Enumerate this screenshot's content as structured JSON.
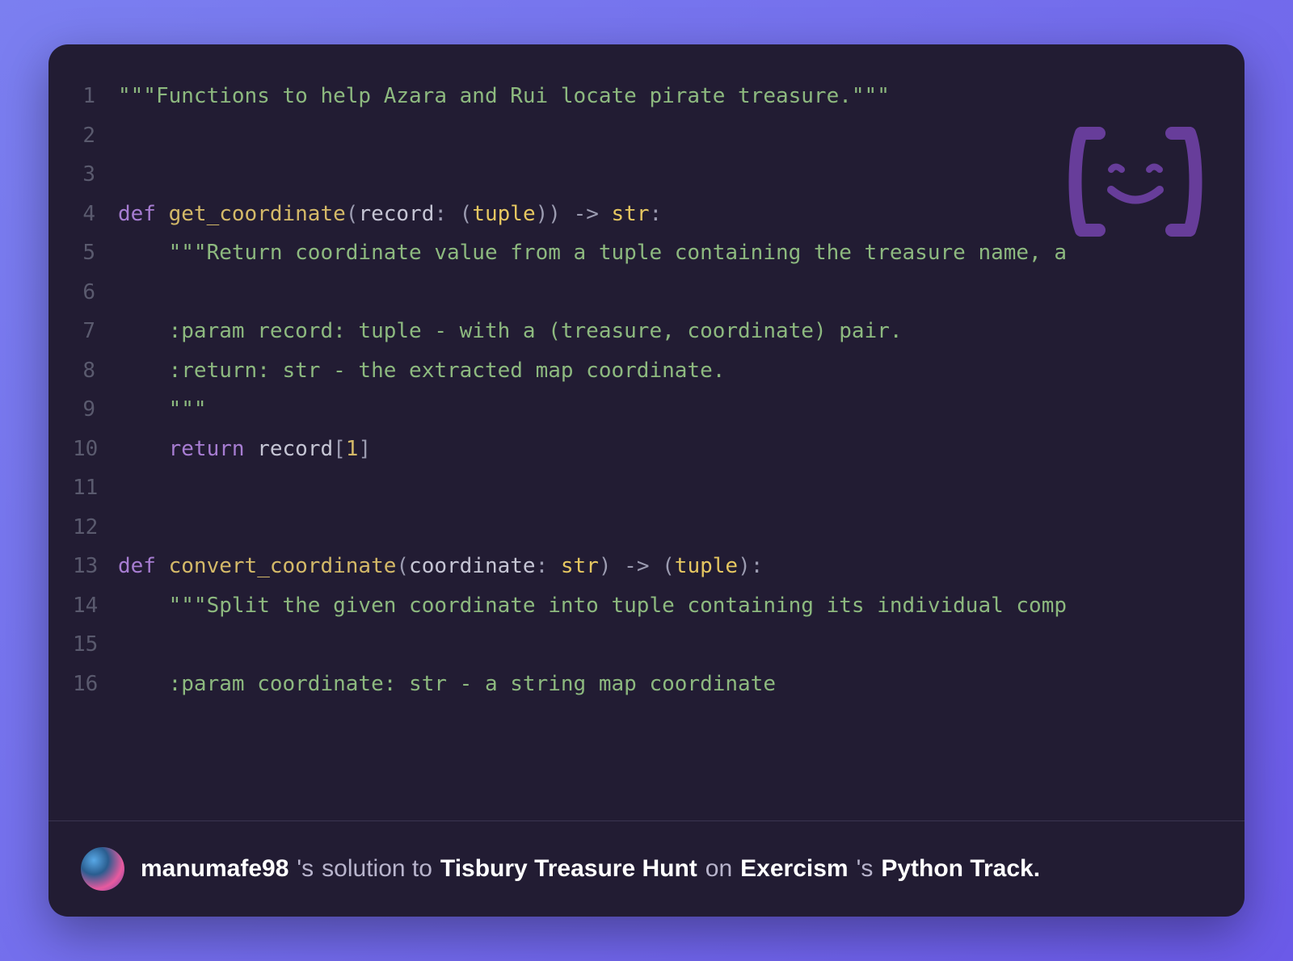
{
  "code": {
    "lines": [
      {
        "n": 1,
        "tokens": [
          [
            "t-str",
            "\"\"\"Functions to help Azara and Rui locate pirate treasure.\"\"\""
          ]
        ]
      },
      {
        "n": 2,
        "tokens": []
      },
      {
        "n": 3,
        "tokens": []
      },
      {
        "n": 4,
        "tokens": [
          [
            "t-key",
            "def "
          ],
          [
            "t-func",
            "get_coordinate"
          ],
          [
            "t-punct",
            "("
          ],
          [
            "t-param",
            "record"
          ],
          [
            "t-punct",
            ": ("
          ],
          [
            "t-type",
            "tuple"
          ],
          [
            "t-punct",
            ")) -> "
          ],
          [
            "t-type",
            "str"
          ],
          [
            "t-punct",
            ":"
          ]
        ]
      },
      {
        "n": 5,
        "tokens": [
          [
            "",
            "    "
          ],
          [
            "t-str",
            "\"\"\"Return coordinate value from a tuple containing the treasure name, a"
          ]
        ]
      },
      {
        "n": 6,
        "tokens": []
      },
      {
        "n": 7,
        "tokens": [
          [
            "",
            "    "
          ],
          [
            "t-str",
            ":param record: tuple - with a (treasure, coordinate) pair."
          ]
        ]
      },
      {
        "n": 8,
        "tokens": [
          [
            "",
            "    "
          ],
          [
            "t-str",
            ":return: str - the extracted map coordinate."
          ]
        ]
      },
      {
        "n": 9,
        "tokens": [
          [
            "",
            "    "
          ],
          [
            "t-str",
            "\"\"\""
          ]
        ]
      },
      {
        "n": 10,
        "tokens": [
          [
            "",
            "    "
          ],
          [
            "t-key",
            "return"
          ],
          [
            "",
            ""
          ],
          [
            "t-param",
            " record"
          ],
          [
            "t-punct",
            "["
          ],
          [
            "t-num",
            "1"
          ],
          [
            "t-punct",
            "]"
          ]
        ]
      },
      {
        "n": 11,
        "tokens": []
      },
      {
        "n": 12,
        "tokens": []
      },
      {
        "n": 13,
        "tokens": [
          [
            "t-key",
            "def "
          ],
          [
            "t-func",
            "convert_coordinate"
          ],
          [
            "t-punct",
            "("
          ],
          [
            "t-param",
            "coordinate"
          ],
          [
            "t-punct",
            ": "
          ],
          [
            "t-type",
            "str"
          ],
          [
            "t-punct",
            ") -> ("
          ],
          [
            "t-type",
            "tuple"
          ],
          [
            "t-punct",
            "):"
          ]
        ]
      },
      {
        "n": 14,
        "tokens": [
          [
            "",
            "    "
          ],
          [
            "t-str",
            "\"\"\"Split the given coordinate into tuple containing its individual comp"
          ]
        ]
      },
      {
        "n": 15,
        "tokens": []
      },
      {
        "n": 16,
        "tokens": [
          [
            "",
            "    "
          ],
          [
            "t-str",
            ":param coordinate: str - a string map coordinate"
          ]
        ]
      }
    ]
  },
  "footer": {
    "username": "manumafe98",
    "text1": "'s",
    "text2": "solution to",
    "exercise": "Tisbury Treasure Hunt",
    "text3": "on",
    "platform": "Exercism",
    "text4": "'s",
    "track": "Python Track."
  }
}
